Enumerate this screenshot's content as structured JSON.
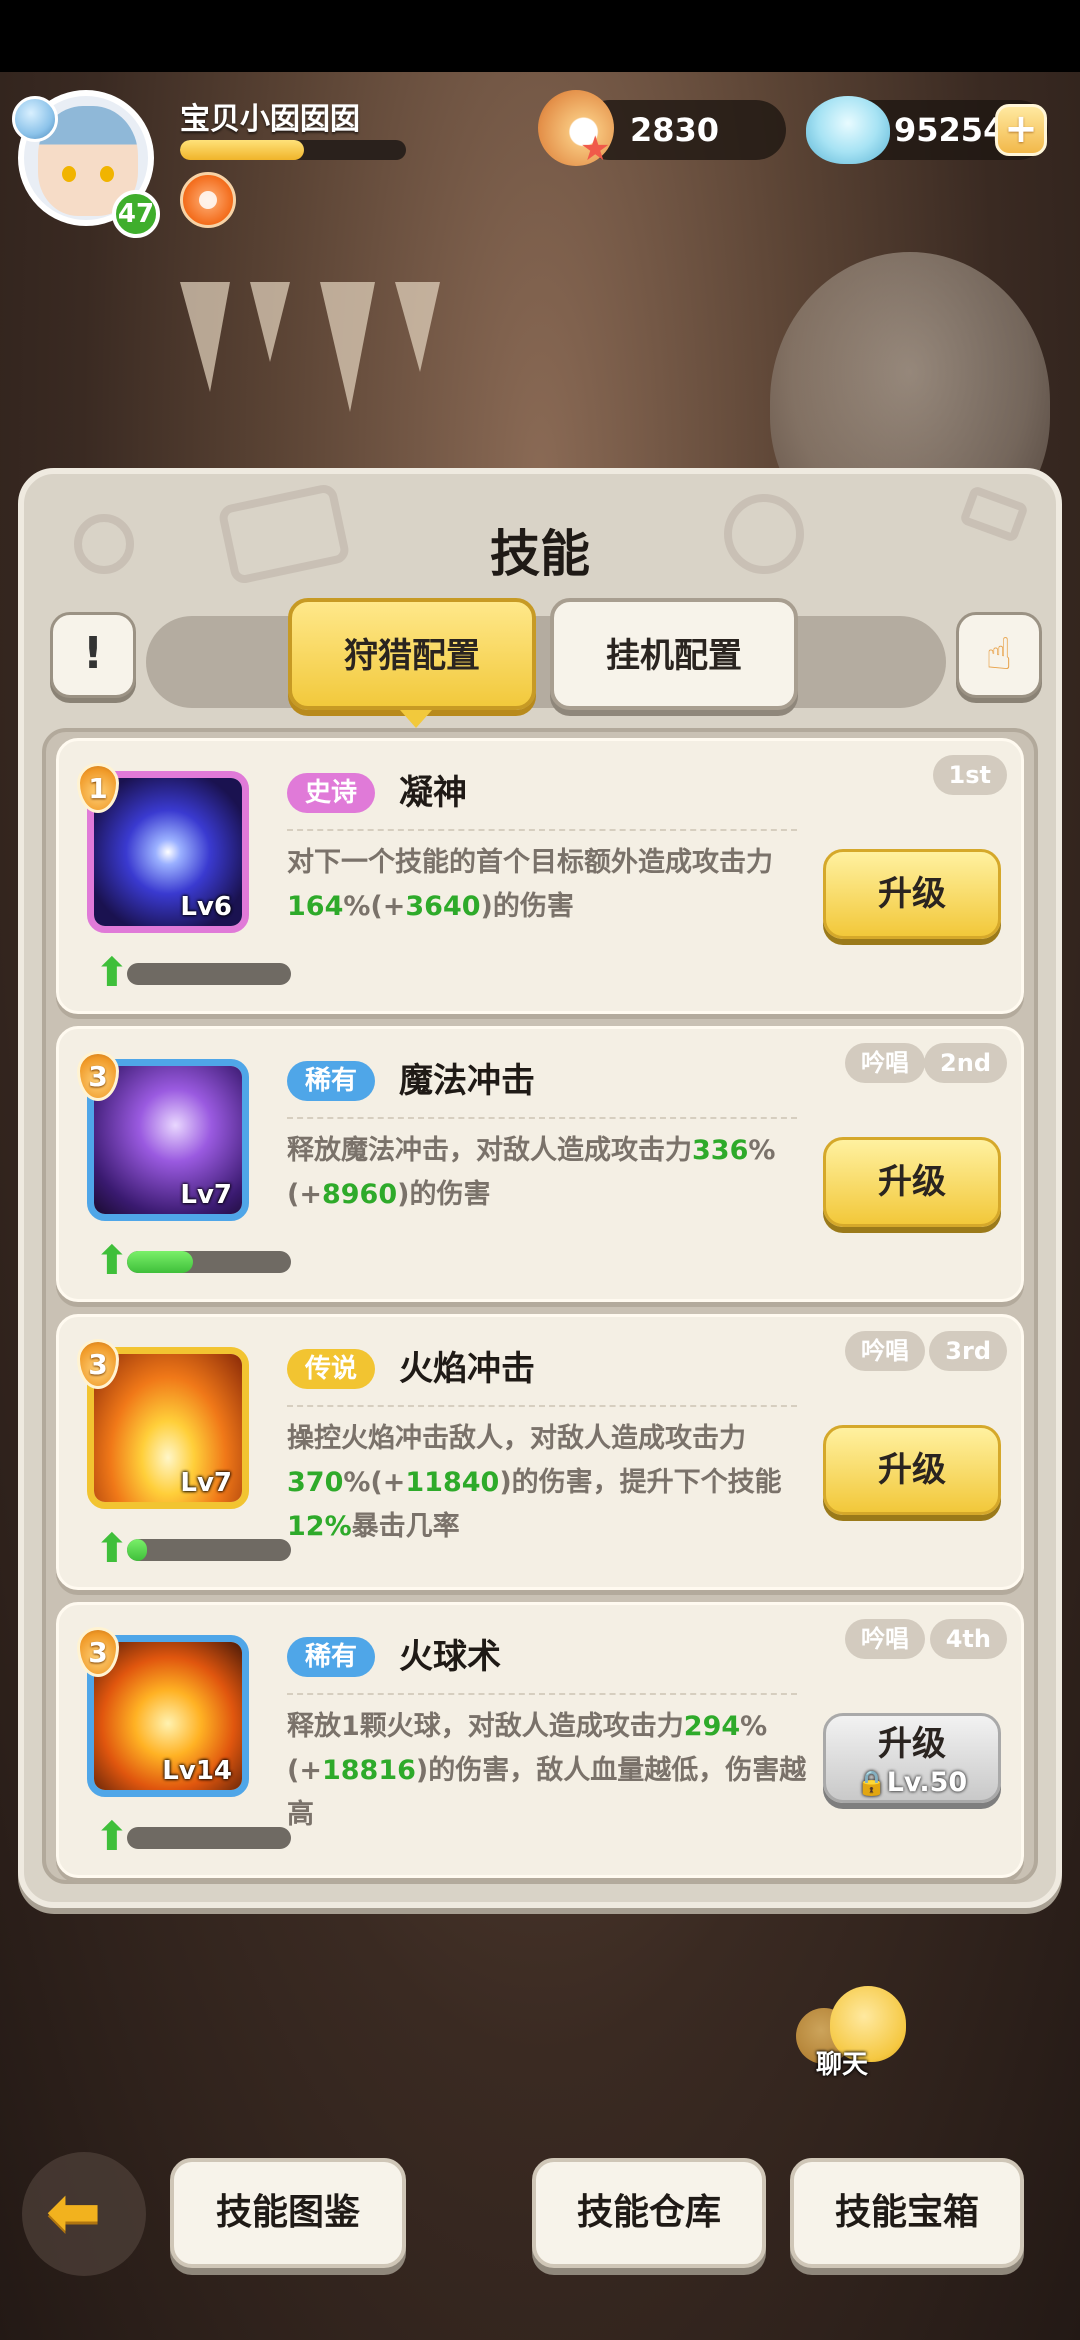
{
  "player": {
    "name": "宝贝小囡囡囡",
    "level": "47",
    "exp_fraction": 0.55
  },
  "currencies": {
    "pearl": "2830",
    "gem": "95254"
  },
  "panel": {
    "title": "技能",
    "tabs": [
      {
        "label": "狩猎配置",
        "active": true
      },
      {
        "label": "挂机配置",
        "active": false
      }
    ]
  },
  "skills": [
    {
      "slot": "1",
      "rarity": "史诗",
      "rarity_color": "#e07ad8",
      "name": "凝神",
      "level": "Lv6",
      "frame_color": "#e07ad8",
      "progress": 0,
      "desc_parts": [
        "对下一个技能的首个目标额外造成攻击力",
        "164",
        "%(+",
        "3640",
        ")的伤害"
      ],
      "tags": [
        "1st"
      ],
      "button": "升级",
      "locked": false
    },
    {
      "slot": "3",
      "rarity": "稀有",
      "rarity_color": "#4fa6e8",
      "name": "魔法冲击",
      "level": "Lv7",
      "frame_color": "#4fa6e8",
      "progress": 0.4,
      "desc_parts": [
        "释放魔法冲击，对敌人造成攻击力",
        "336",
        "%(+",
        "8960",
        ")的伤害"
      ],
      "tags": [
        "吟唱",
        "2nd"
      ],
      "button": "升级",
      "locked": false
    },
    {
      "slot": "3",
      "rarity": "传说",
      "rarity_color": "#f2c431",
      "name": "火焰冲击",
      "level": "Lv7",
      "frame_color": "#f2c431",
      "progress": 0.12,
      "desc_parts": [
        "操控火焰冲击敌人，对敌人造成攻击力",
        "370",
        "%(+",
        "11840",
        ")的伤害，提升下个技能",
        "12%",
        "暴击几率"
      ],
      "tags": [
        "吟唱",
        "3rd"
      ],
      "button": "升级",
      "locked": false
    },
    {
      "slot": "3",
      "rarity": "稀有",
      "rarity_color": "#4fa6e8",
      "name": "火球术",
      "level": "Lv14",
      "frame_color": "#4fa6e8",
      "progress": 0,
      "desc_parts": [
        "释放1颗火球，对敌人造成攻击力",
        "294",
        "%(+",
        "18816",
        ")的伤害，敌人血量越低，伤害越高"
      ],
      "tags": [
        "吟唱",
        "4th"
      ],
      "button": "升级",
      "locked": true,
      "unlock_req": "Lv.50"
    }
  ],
  "chat": {
    "label": "聊天"
  },
  "bottom": {
    "codex": "技能图鉴",
    "warehouse": "技能仓库",
    "chest": "技能宝箱"
  },
  "icons": {
    "back": "back-arrow-icon",
    "info": "exclamation-icon",
    "hand": "hand-pointer-icon",
    "plus": "plus-icon",
    "lock": "lock-icon",
    "upgrade": "up-arrow-icon"
  }
}
